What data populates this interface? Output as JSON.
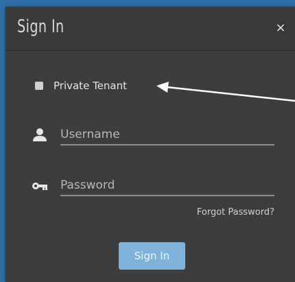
{
  "dialog": {
    "title": "Sign In",
    "close_symbol": "×"
  },
  "private_tenant": {
    "label": "Private Tenant",
    "checked": false
  },
  "username": {
    "placeholder": "Username",
    "icon": "user-icon"
  },
  "password": {
    "placeholder": "Password",
    "icon": "key-icon"
  },
  "forgot_password": "Forgot Password?",
  "sign_in_button": "Sign In",
  "colors": {
    "backdrop": "#2f6fa8",
    "dialog": "#3d3d3d",
    "button": "#7fb3dc"
  }
}
